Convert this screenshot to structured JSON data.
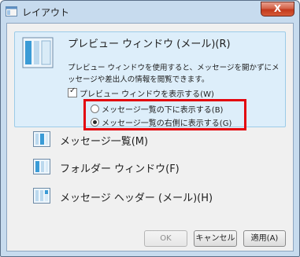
{
  "window": {
    "title": "レイアウト",
    "close_label": "X"
  },
  "preview_pane": {
    "label": "プレビュー ウィンドウ (メール)(R)",
    "description": "プレビュー ウィンドウを使用すると、メッセージを開かずにメッセージや差出人の情報を閲覧できます。",
    "show_checkbox_label": "プレビュー ウィンドウを表示する(W)",
    "show_checked": true,
    "radio_options": [
      {
        "label": "メッセージ一覧の下に表示する(B)",
        "selected": false
      },
      {
        "label": "メッセージ一覧の右側に表示する(G)",
        "selected": true
      }
    ]
  },
  "items": [
    {
      "label": "メッセージ一覧(M)"
    },
    {
      "label": "フォルダー ウィンドウ(F)"
    },
    {
      "label": "メッセージ ヘッダー (メール)(H)"
    }
  ],
  "buttons": {
    "ok": "OK",
    "cancel": "キャンセル",
    "apply": "適用(A)"
  },
  "colors": {
    "highlight_border": "#e3060f",
    "panel_bg": "#ddeefa"
  }
}
